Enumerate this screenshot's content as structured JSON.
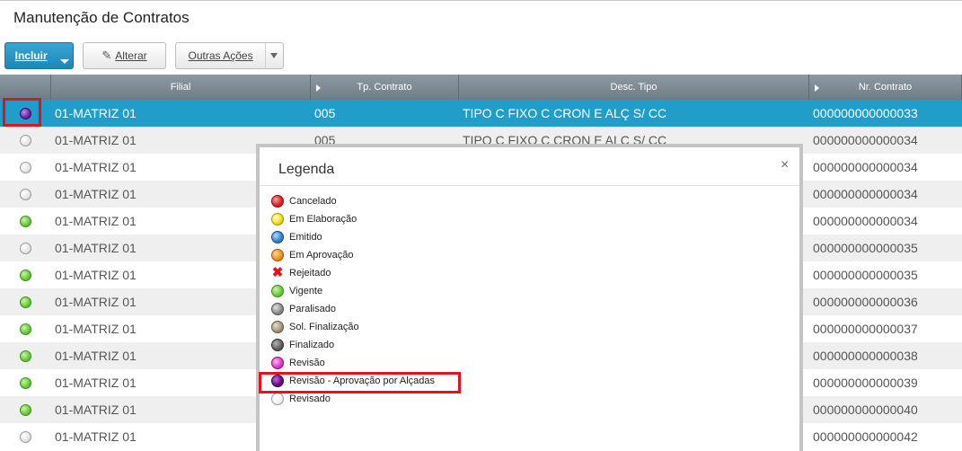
{
  "page": {
    "title": "Manutenção de Contratos"
  },
  "toolbar": {
    "incluir": "Incluir",
    "alterar": "Alterar",
    "outras": "Outras Ações"
  },
  "grid": {
    "columns": [
      "",
      "Filial",
      "Tp. Contrato",
      "Desc. Tipo",
      "Nr. Contrato"
    ],
    "rows": [
      {
        "status": "purple",
        "filial": "01-MATRIZ 01",
        "tp": "005",
        "desc": "TIPO C FIXO C CRON E ALÇ S/ CC",
        "nr": "000000000000033",
        "selected": true
      },
      {
        "status": "grey",
        "filial": "01-MATRIZ 01",
        "tp": "005",
        "desc": "TIPO C FIXO C CRON E ALÇ S/ CC",
        "nr": "000000000000034"
      },
      {
        "status": "grey",
        "filial": "01-MATRIZ 01",
        "tp": "",
        "desc": "",
        "nr": "000000000000034"
      },
      {
        "status": "grey",
        "filial": "01-MATRIZ 01",
        "tp": "",
        "desc": "",
        "nr": "000000000000034"
      },
      {
        "status": "green",
        "filial": "01-MATRIZ 01",
        "tp": "",
        "desc": "",
        "nr": "000000000000034"
      },
      {
        "status": "grey",
        "filial": "01-MATRIZ 01",
        "tp": "",
        "desc": "",
        "nr": "000000000000035"
      },
      {
        "status": "green",
        "filial": "01-MATRIZ 01",
        "tp": "",
        "desc": "",
        "nr": "000000000000035"
      },
      {
        "status": "green",
        "filial": "01-MATRIZ 01",
        "tp": "",
        "desc": "",
        "nr": "000000000000036"
      },
      {
        "status": "green",
        "filial": "01-MATRIZ 01",
        "tp": "",
        "desc": "",
        "nr": "000000000000037"
      },
      {
        "status": "green",
        "filial": "01-MATRIZ 01",
        "tp": "",
        "desc": "",
        "nr": "000000000000038"
      },
      {
        "status": "green",
        "filial": "01-MATRIZ 01",
        "tp": "",
        "desc": "",
        "nr": "000000000000039"
      },
      {
        "status": "green",
        "filial": "01-MATRIZ 01",
        "tp": "",
        "desc": "",
        "nr": "000000000000040"
      },
      {
        "status": "grey",
        "filial": "01-MATRIZ 01",
        "tp": "",
        "desc": "",
        "nr": "000000000000042"
      }
    ]
  },
  "legend": {
    "title": "Legenda",
    "close": "×",
    "items": [
      {
        "label": "Cancelado",
        "icon": "red"
      },
      {
        "label": "Em Elaboração",
        "icon": "yellow"
      },
      {
        "label": "Emitido",
        "icon": "blue"
      },
      {
        "label": "Em Aprovação",
        "icon": "orange"
      },
      {
        "label": "Rejeitado",
        "icon": "x-mark"
      },
      {
        "label": "Vigente",
        "icon": "green"
      },
      {
        "label": "Paralisado",
        "icon": "grey"
      },
      {
        "label": "Sol. Finalização",
        "icon": "khaki"
      },
      {
        "label": "Finalizado",
        "icon": "dark"
      },
      {
        "label": "Revisão",
        "icon": "magenta"
      },
      {
        "label": "Revisão - Aprovação por Alçadas",
        "icon": "purple"
      },
      {
        "label": "Revisado",
        "icon": "white"
      }
    ]
  },
  "colors": {
    "selected_row": "#209ec9",
    "primary_button": "#1d86b8",
    "highlight": "#e0141e"
  }
}
